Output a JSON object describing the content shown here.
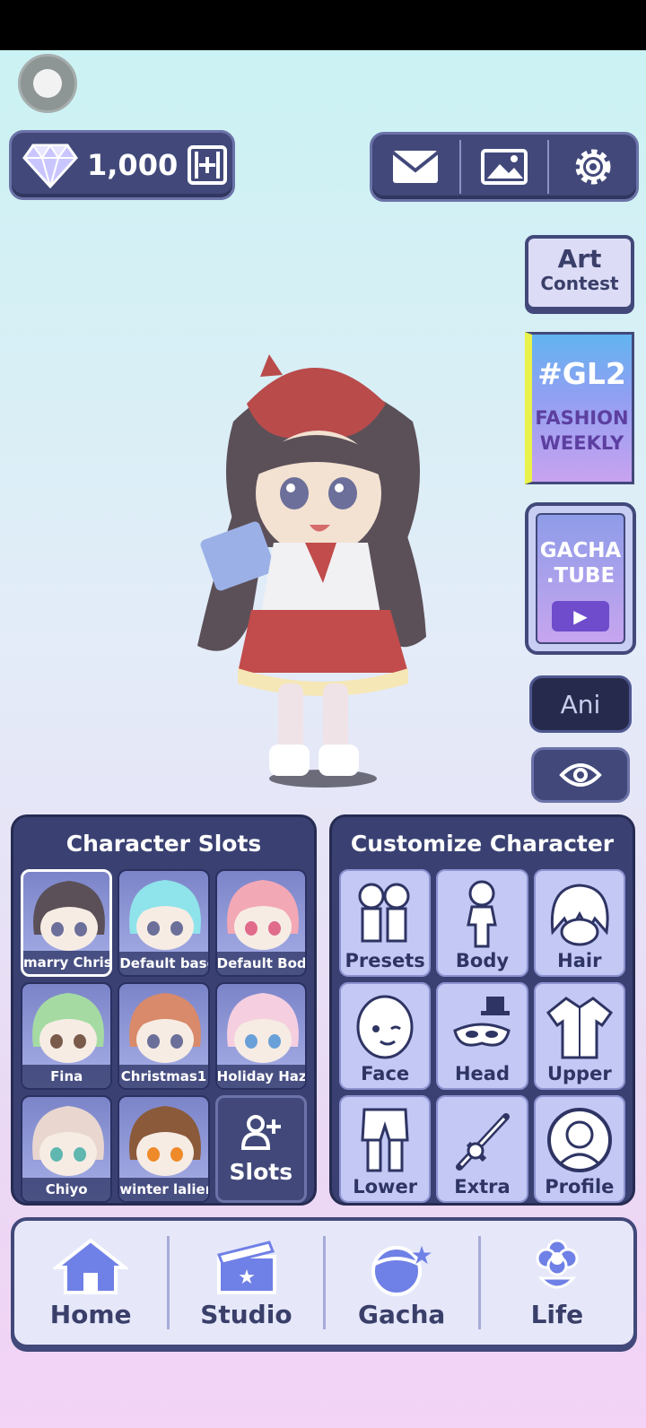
{
  "currency": {
    "gems": "1,000"
  },
  "side": {
    "art_contest": {
      "line1": "Art",
      "line2": "Contest"
    },
    "fashion": {
      "tag": "#GL2",
      "line1": "FASHION",
      "line2": "WEEKLY"
    },
    "tube": {
      "line1": "GACHA",
      "line2": ".TUBE"
    },
    "ani": "Ani"
  },
  "slots": {
    "title": "Character Slots",
    "items": [
      {
        "name": "marry Christm",
        "hair": "#5b5058",
        "eyes": "#6b6f99",
        "selected": true
      },
      {
        "name": "Default base",
        "hair": "#8fe3ea",
        "eyes": "#6b6f99"
      },
      {
        "name": "Default Body",
        "hair": "#f3a8b6",
        "eyes": "#e06b8b"
      },
      {
        "name": "Fina",
        "hair": "#a5dba3",
        "eyes": "#7a5a4a"
      },
      {
        "name": "Christmas1",
        "hair": "#d98a6a",
        "eyes": "#6b6f99"
      },
      {
        "name": "Holiday Hazel",
        "hair": "#f5cfe0",
        "eyes": "#6aa0d8"
      },
      {
        "name": "Chiyo",
        "hair": "#e9d6cf",
        "eyes": "#5fb7b0"
      },
      {
        "name": "winter lalien",
        "hair": "#8a5a3a",
        "eyes": "#ee8a2a"
      }
    ],
    "add_label": "Slots"
  },
  "customize": {
    "title": "Customize Character",
    "items": [
      "Presets",
      "Body",
      "Hair",
      "Face",
      "Head",
      "Upper",
      "Lower",
      "Extra",
      "Profile"
    ]
  },
  "nav": {
    "items": [
      "Home",
      "Studio",
      "Gacha",
      "Life"
    ]
  }
}
